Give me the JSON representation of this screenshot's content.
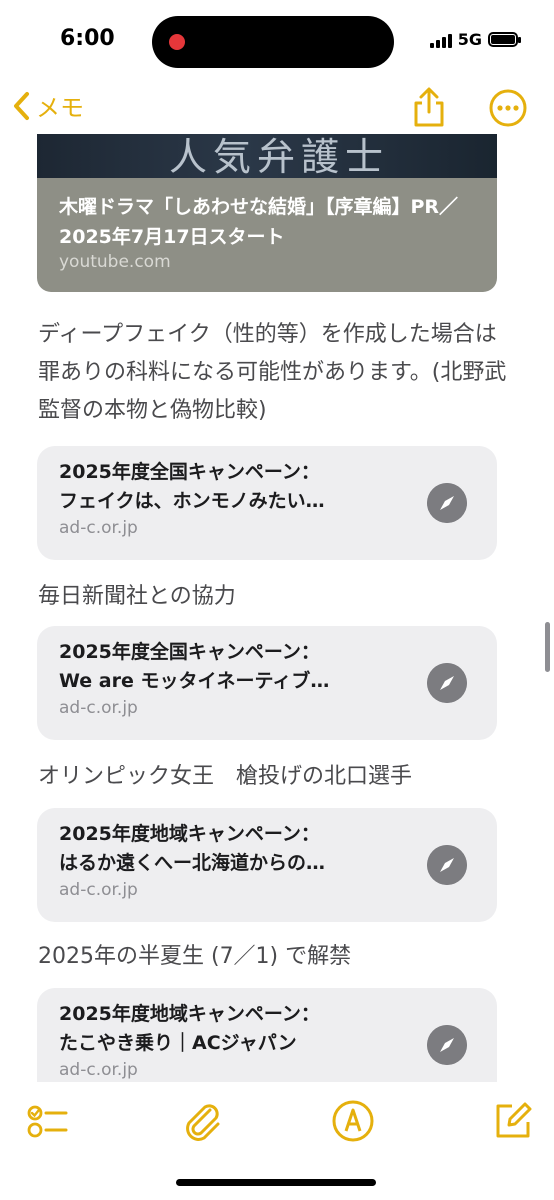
{
  "status_bar": {
    "time": "6:00",
    "network": "5G"
  },
  "nav": {
    "back_label": "メモ"
  },
  "video_card": {
    "thumbnail_text": "人気弁護士",
    "title": "木曜ドラマ「しあわせな結婚」【序章編】PR／2025年7月17日スタート",
    "domain": "youtube.com"
  },
  "notes": [
    {
      "text": "ディープフェイク（性的等）を作成した場合は罪ありの科料になる可能性があります。(北野武監督の本物と偽物比較)"
    },
    {
      "text": "毎日新聞社との協力"
    },
    {
      "text": "オリンピック女王　槍投げの北口選手"
    },
    {
      "text": "2025年の半夏生 (7／1) で解禁"
    }
  ],
  "links": [
    {
      "line1": "2025年度全国キャンペーン：",
      "line2": "フェイクは、ホンモノみたい…",
      "domain": "ad-c.or.jp"
    },
    {
      "line1": "2025年度全国キャンペーン：",
      "line2": "We are モッタイネーティブ…",
      "domain": "ad-c.or.jp"
    },
    {
      "line1": "2025年度地域キャンペーン：",
      "line2": "はるか遠くへー北海道からの…",
      "domain": "ad-c.or.jp"
    },
    {
      "line1": "2025年度地域キャンペーン：",
      "line2": "たこやき乗り｜ACジャパン",
      "domain": "ad-c.or.jp"
    }
  ],
  "colors": {
    "accent": "#e5b00d",
    "card_bg": "#eeeef0",
    "compass": "#7c7c80"
  },
  "icons": [
    "chevron-left-icon",
    "share-icon",
    "more-icon",
    "compass-icon",
    "checklist-icon",
    "paperclip-icon",
    "markup-icon",
    "compose-icon"
  ]
}
